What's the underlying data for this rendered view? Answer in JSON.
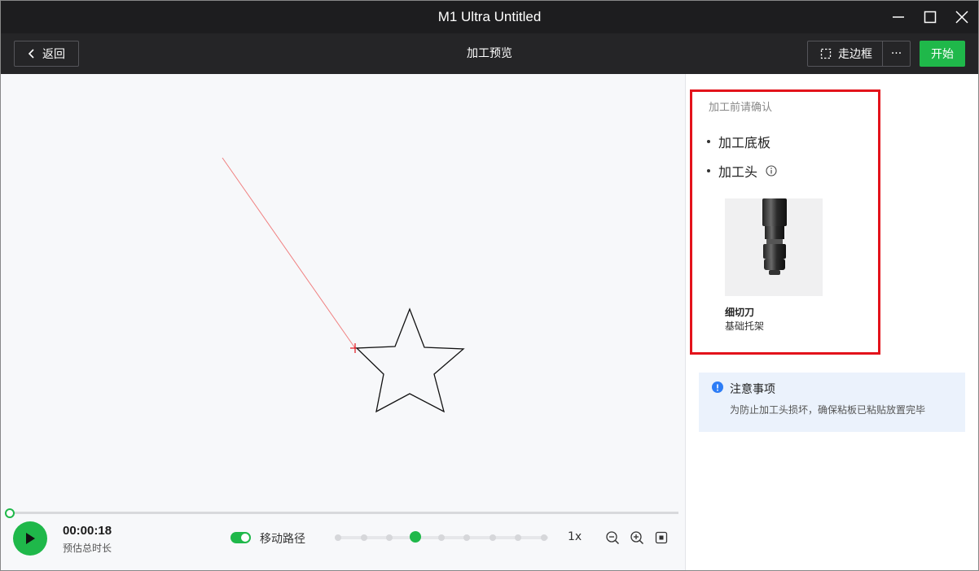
{
  "window": {
    "title": "M1 Ultra Untitled",
    "controls": [
      "minimize-icon",
      "maximize-icon",
      "close-icon"
    ]
  },
  "toolbar": {
    "back_label": "返回",
    "page_title": "加工预览",
    "frame_label": "走边框",
    "more_label": "···",
    "start_label": "开始"
  },
  "playback": {
    "time": "00:00:18",
    "time_label": "预估总时长",
    "progress": 0.0,
    "move_path_label": "移动路径",
    "move_path_on": true,
    "speed_steps": 9,
    "speed_active_index": 3,
    "speed_label": "1x",
    "icons": [
      "zoom-out-icon",
      "zoom-in-icon",
      "fit-view-icon"
    ]
  },
  "confirm": {
    "heading": "加工前请确认",
    "items": [
      "加工底板",
      "加工头"
    ],
    "info_icon": "info-icon",
    "tool_name": "细切刀",
    "tool_holder": "基础托架"
  },
  "notice": {
    "title": "注意事项",
    "text": "为防止加工头损坏，确保粘板已粘贴放置完毕"
  },
  "colors": {
    "accent": "#1fb84a",
    "highlight_box": "#e3131b",
    "path_line": "#f08080",
    "titlebar": "#1d1d1f"
  }
}
